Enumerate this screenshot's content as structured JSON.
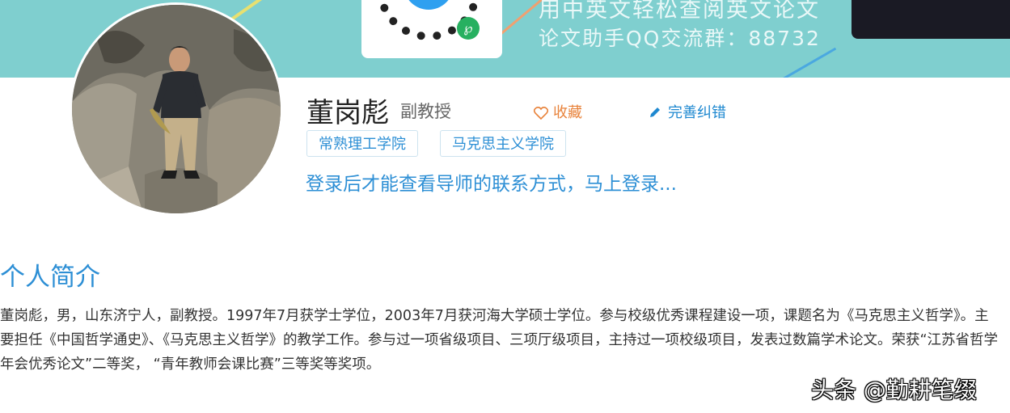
{
  "banner": {
    "line1": "用中英文轻松查阅英文论文",
    "line2": "论文助手QQ交流群：88732",
    "colors": {
      "bg": "#7fcfcf",
      "qr_center": "#2fa0f0",
      "badge": "#27b060"
    }
  },
  "profile": {
    "name": "董岗彪",
    "rank": "副教授",
    "favorite_label": "收藏",
    "edit_label": "完善纠错",
    "tags": [
      "常熟理工学院",
      "马克思主义学院"
    ],
    "login_hint": "登录后才能查看导师的联系方式，马上登录..."
  },
  "intro": {
    "title": "个人简介",
    "text": "董岗彪，男，山东济宁人，副教授。1997年7月获学士学位，2003年7月获河海大学硕士学位。参与校级优秀课程建设一项，课题名为《马克思主义哲学》。主要担任《中国哲学通史》、《马克思主义哲学》的教学工作。参与过一项省级项目、三项厅级项目，主持过一项校级项目，发表过数篇学术论文。荣获“江苏省哲学年会优秀论文”二等奖， “青年教师会课比赛”三等奖等奖项。"
  },
  "watermark": "头条 @勤耕笔缀",
  "icons": {
    "favorite": "heart-outline-icon",
    "edit": "pencil-icon",
    "miniprogram": "wechat-miniprogram-icon"
  }
}
